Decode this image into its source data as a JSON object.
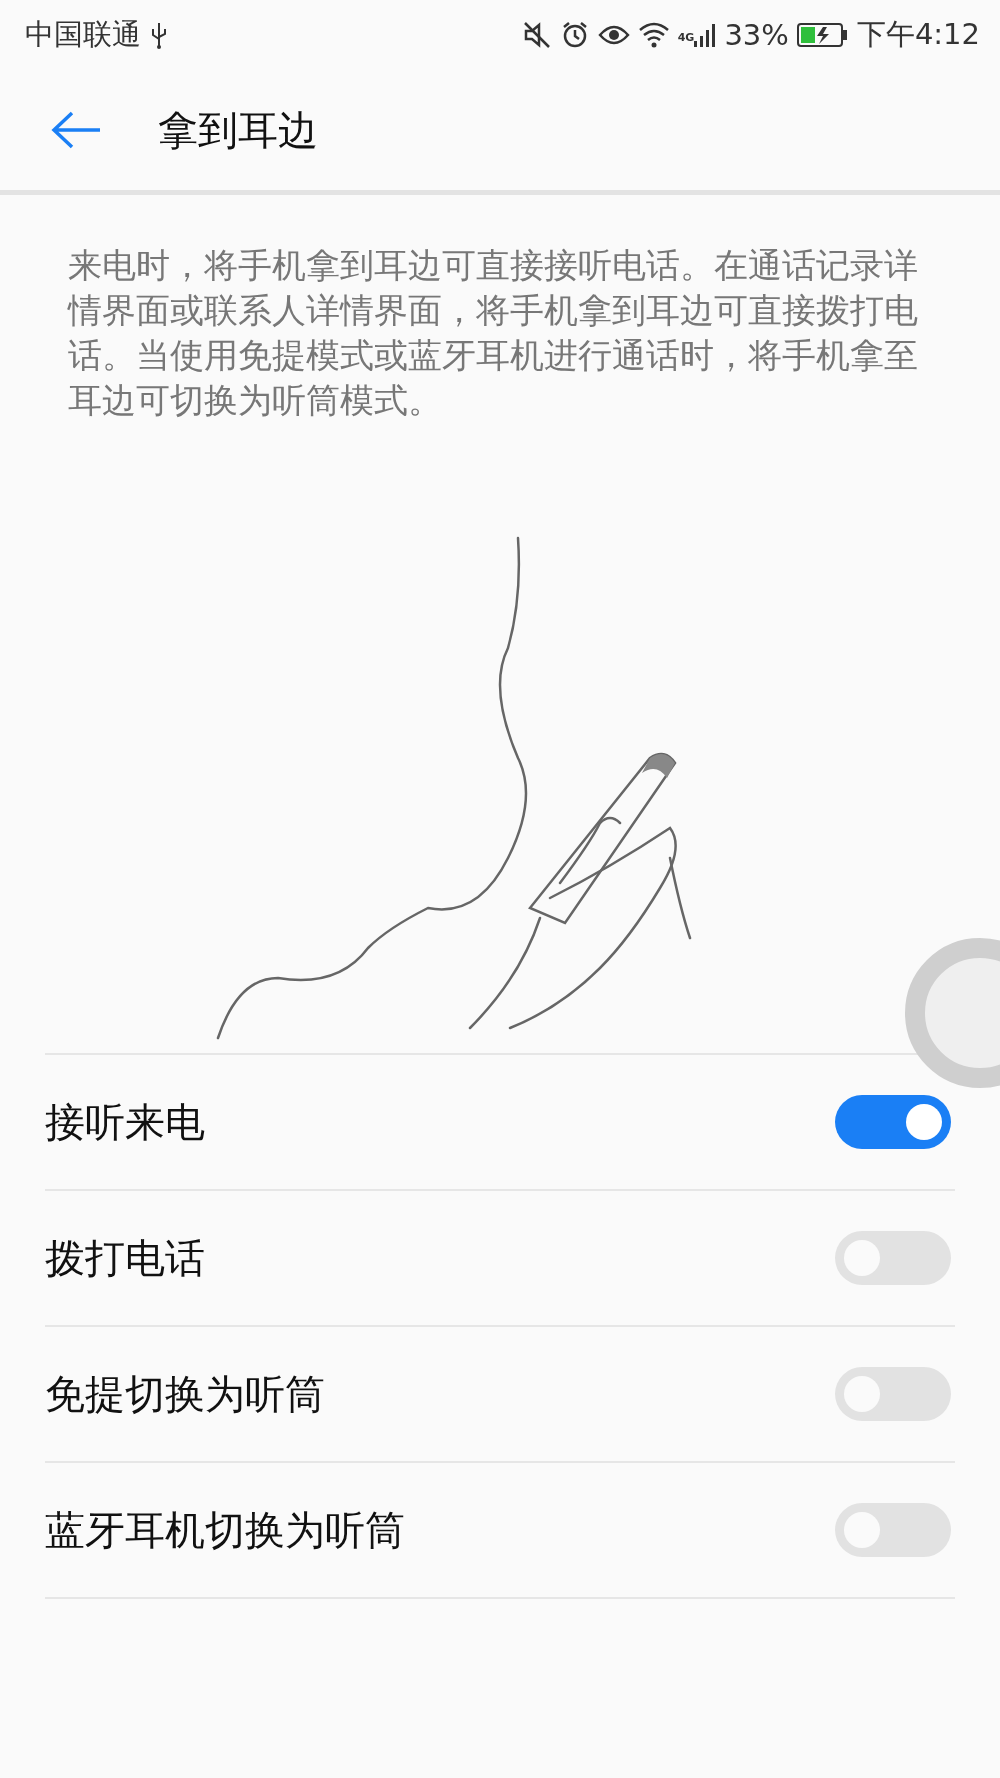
{
  "status_bar": {
    "carrier": "中国联通",
    "network": "4G",
    "battery": "33%",
    "time": "下午4:12"
  },
  "header": {
    "title": "拿到耳边"
  },
  "description": "来电时，将手机拿到耳边可直接接听电话。在通话记录详情界面或联系人详情界面，将手机拿到耳边可直接拨打电话。当使用免提模式或蓝牙耳机进行通话时，将手机拿至耳边可切换为听筒模式。",
  "settings": [
    {
      "label": "接听来电",
      "on": true
    },
    {
      "label": "拨打电话",
      "on": false
    },
    {
      "label": "免提切换为听筒",
      "on": false
    },
    {
      "label": "蓝牙耳机切换为听筒",
      "on": false
    }
  ]
}
